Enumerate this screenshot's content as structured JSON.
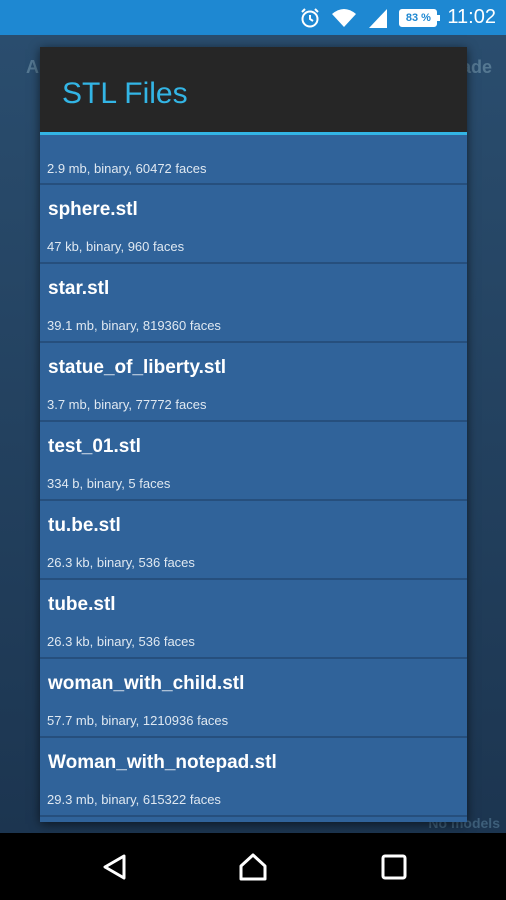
{
  "status_bar": {
    "battery_percent": "83 %",
    "time": "11:02",
    "icons": [
      "alarm-icon",
      "wifi-icon",
      "signal-icon",
      "battery-icon"
    ]
  },
  "background": {
    "left_text": "A",
    "right_text": "ade",
    "bottom_text": "No models"
  },
  "dialog": {
    "title": "STL Files",
    "partial_first_meta": "2.9 mb, binary, 60472 faces",
    "files": [
      {
        "name": "sphere.stl",
        "meta": "47 kb, binary, 960 faces"
      },
      {
        "name": "star.stl",
        "meta": "39.1 mb, binary, 819360 faces"
      },
      {
        "name": "statue_of_liberty.stl",
        "meta": "3.7 mb, binary, 77772 faces"
      },
      {
        "name": "test_01.stl",
        "meta": "334 b, binary, 5 faces"
      },
      {
        "name": "tu.be.stl",
        "meta": "26.3 kb, binary, 536 faces"
      },
      {
        "name": "tube.stl",
        "meta": "26.3 kb, binary, 536 faces"
      },
      {
        "name": "woman_with_child.stl",
        "meta": "57.7 mb, binary, 1210936 faces"
      },
      {
        "name": "Woman_with_notepad.stl",
        "meta": "29.3 mb, binary, 615322 faces"
      }
    ]
  },
  "nav_bar": {
    "icons": [
      "back-icon",
      "home-icon",
      "recents-icon"
    ]
  },
  "colors": {
    "status_bar": "#1e88d2",
    "dialog_header": "#262626",
    "accent": "#33b5e5",
    "list_background": "#30639a"
  }
}
